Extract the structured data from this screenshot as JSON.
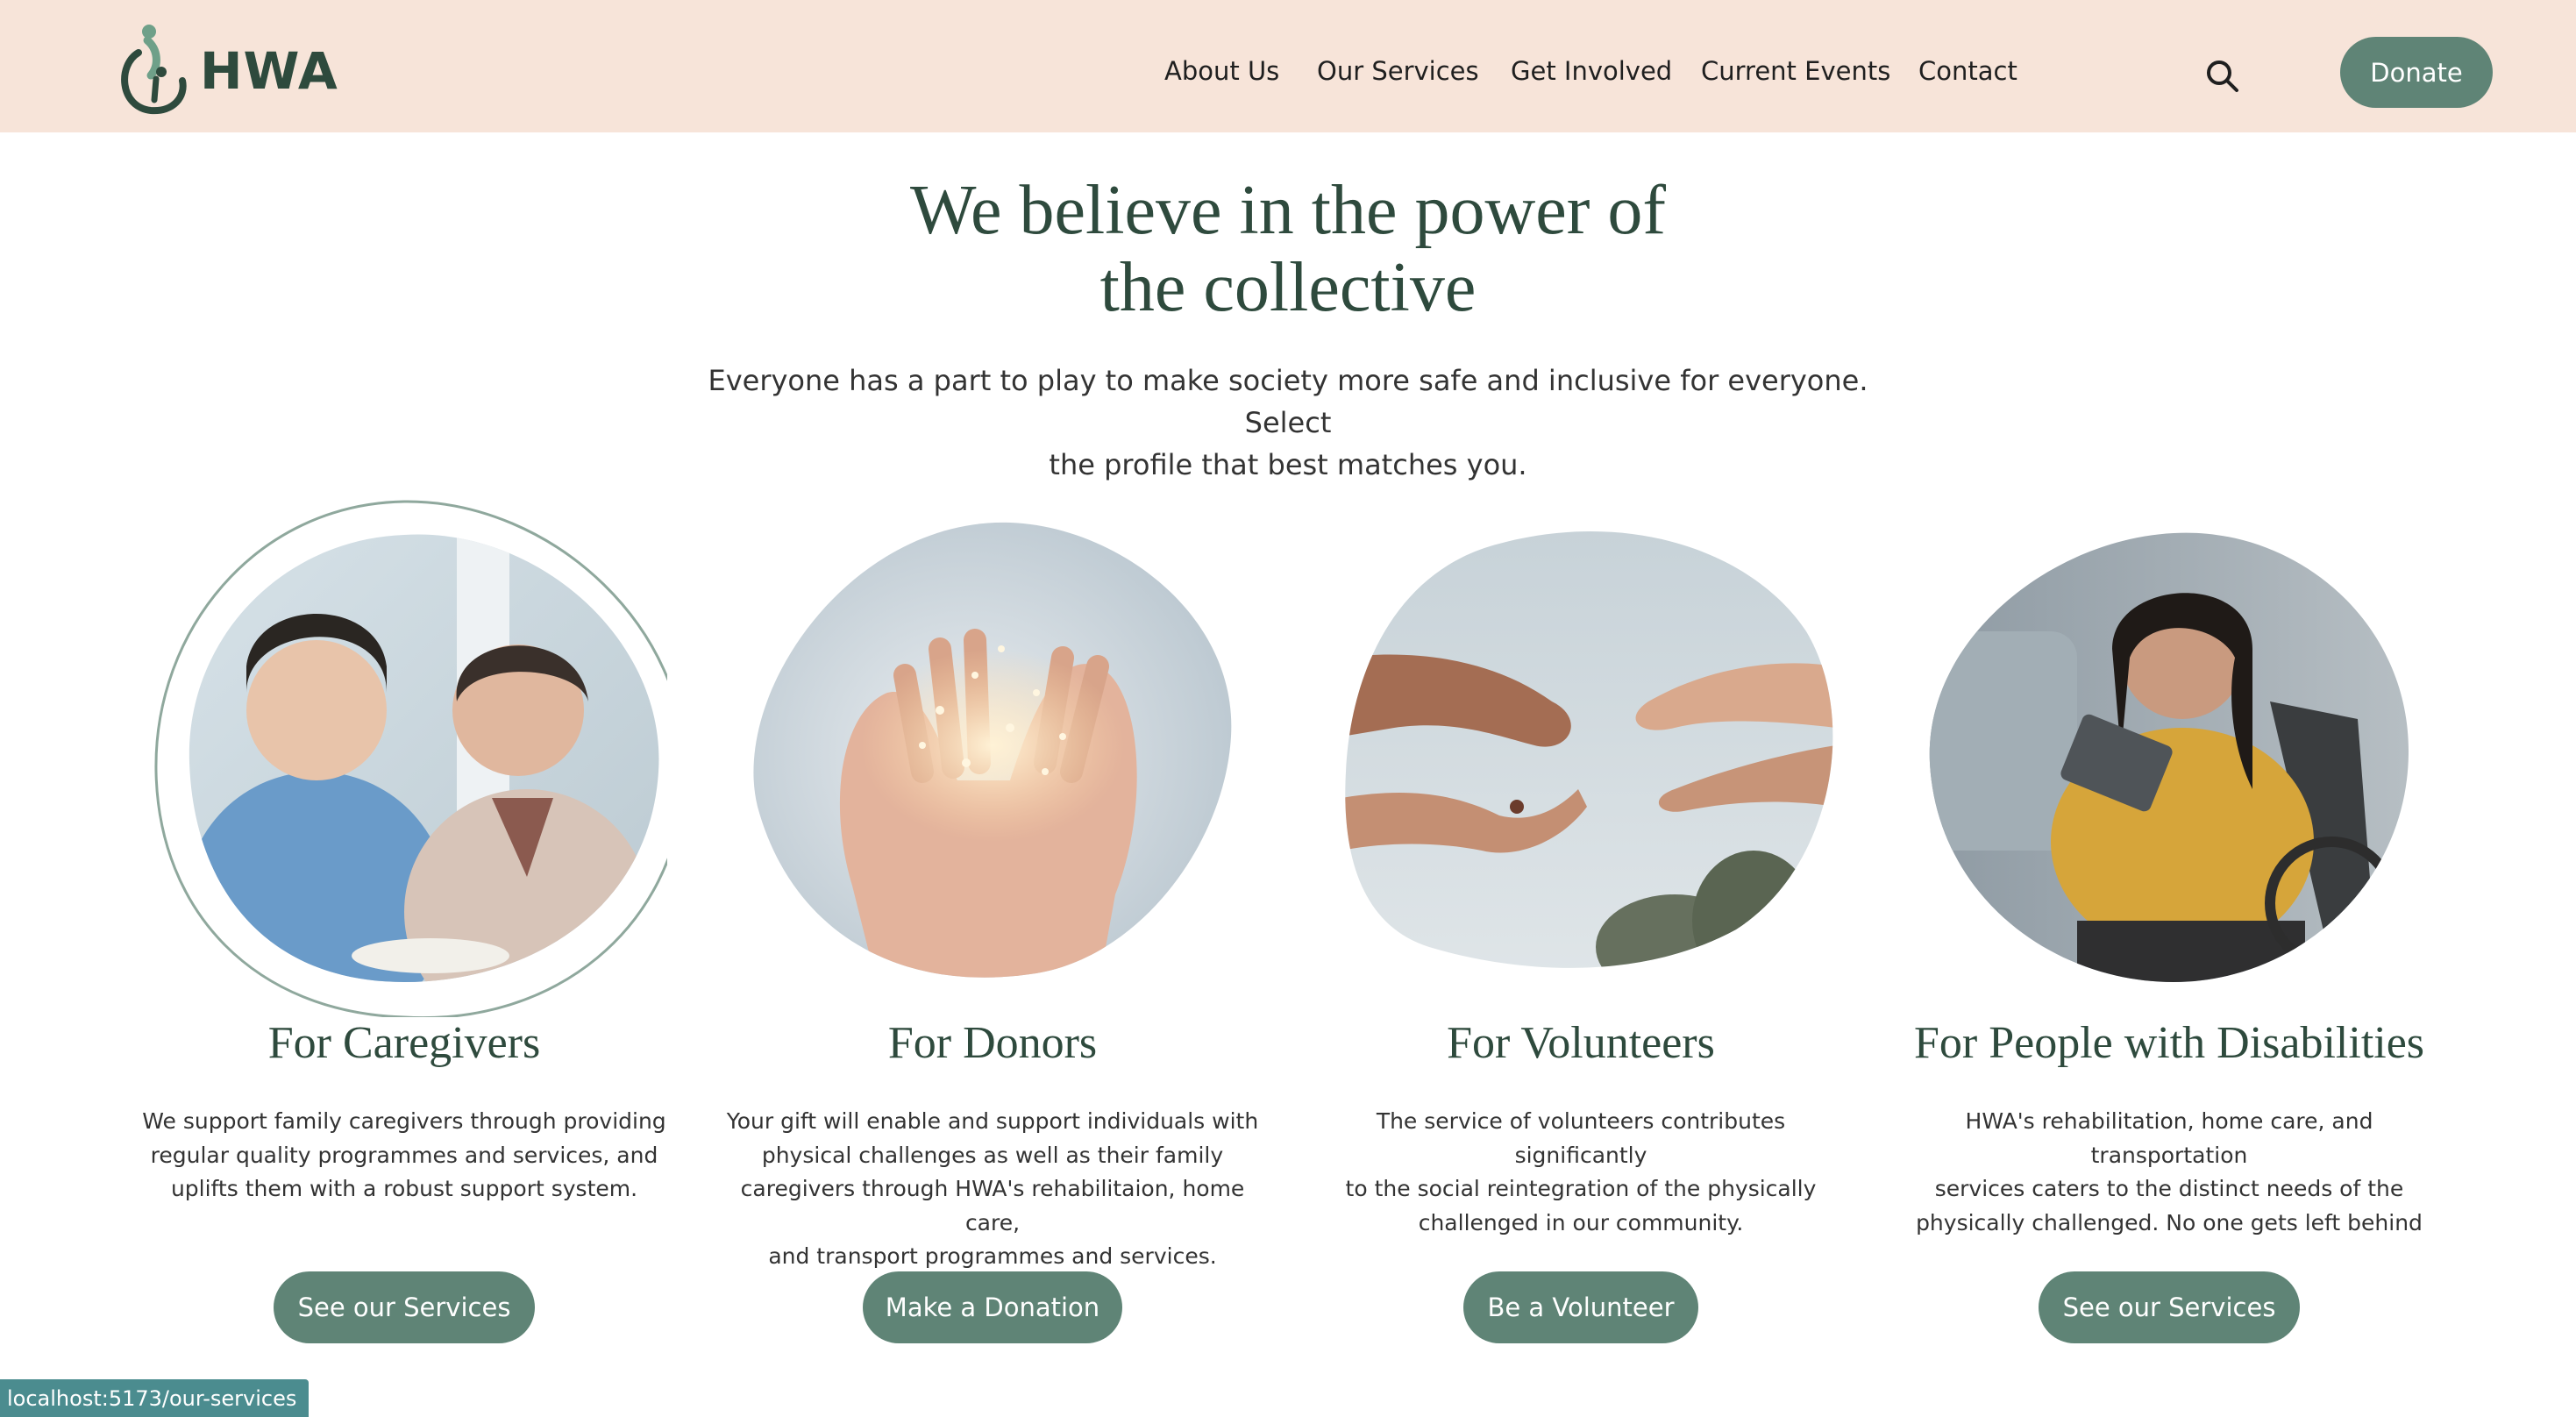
{
  "brand": {
    "name": "HWA",
    "accent": "#5f8476",
    "header_bg": "#f7e4d9",
    "title_color": "#2e4a3d"
  },
  "nav": {
    "items": [
      {
        "label": "About Us"
      },
      {
        "label": "Our Services"
      },
      {
        "label": "Get Involved"
      },
      {
        "label": "Current Events"
      },
      {
        "label": "Contact"
      }
    ],
    "search_icon": "search-icon",
    "donate_label": "Donate"
  },
  "hero": {
    "title_line1": "We believe in the power of",
    "title_line2": "the collective",
    "subtitle_line1": "Everyone has a part to play to make society more safe and inclusive for everyone. Select",
    "subtitle_line2": "the profile that best matches you."
  },
  "cards": [
    {
      "title": "For Caregivers",
      "lines": [
        "We support family caregivers through providing",
        "regular quality programmes and services, and",
        "uplifts them with a robust support system."
      ],
      "button": "See our Services"
    },
    {
      "title": "For Donors",
      "lines": [
        "Your gift will enable and support individuals with",
        "physical challenges as well as their family",
        "caregivers through HWA's rehabilitaion, home care,",
        "and transport programmes and services."
      ],
      "button": "Make a Donation"
    },
    {
      "title": "For Volunteers",
      "lines": [
        "The service of volunteers contributes significantly",
        "to the social reintegration of the physically",
        "challenged in our community."
      ],
      "button": "Be a Volunteer"
    },
    {
      "title": "For People with Disabilities",
      "lines": [
        "HWA's rehabilitation, home care, and transportation",
        "services caters to the distinct needs of the",
        "physically challenged. No one gets left behind"
      ],
      "button": "See our Services"
    }
  ],
  "status_bar": {
    "url": "localhost:5173/our-services"
  }
}
